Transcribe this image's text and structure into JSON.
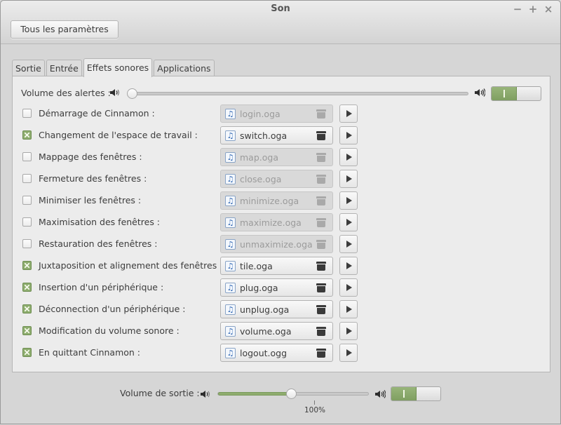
{
  "window": {
    "title": "Son",
    "controls": {
      "minimize": "−",
      "maximize": "+",
      "close": "×"
    }
  },
  "toolbar": {
    "all_settings_label": "Tous les paramètres"
  },
  "tabs": [
    {
      "label": "Sortie",
      "active": false
    },
    {
      "label": "Entrée",
      "active": false
    },
    {
      "label": "Effets sonores",
      "active": true
    },
    {
      "label": "Applications",
      "active": false
    }
  ],
  "alerts": {
    "label": "Volume des alertes :",
    "volume_fraction": 0.0,
    "enabled": true
  },
  "sound_events": [
    {
      "label": "Démarrage de Cinnamon :",
      "checked": false,
      "file": "login.oga"
    },
    {
      "label": "Changement de l'espace de travail :",
      "checked": true,
      "file": "switch.oga"
    },
    {
      "label": "Mappage des fenêtres :",
      "checked": false,
      "file": "map.oga"
    },
    {
      "label": "Fermeture des fenêtres :",
      "checked": false,
      "file": "close.oga"
    },
    {
      "label": "Minimiser les fenêtres :",
      "checked": false,
      "file": "minimize.oga"
    },
    {
      "label": "Maximisation des fenêtres :",
      "checked": false,
      "file": "maximize.oga"
    },
    {
      "label": "Restauration des fenêtres :",
      "checked": false,
      "file": "unmaximize.oga"
    },
    {
      "label": "Juxtaposition et alignement des fenêtres :",
      "checked": true,
      "file": "tile.oga"
    },
    {
      "label": "Insertion d'un périphérique :",
      "checked": true,
      "file": "plug.oga"
    },
    {
      "label": "Déconnection d'un périphérique :",
      "checked": true,
      "file": "unplug.oga"
    },
    {
      "label": "Modification du volume sonore :",
      "checked": true,
      "file": "volume.oga"
    },
    {
      "label": "En quittant Cinnamon :",
      "checked": true,
      "file": "logout.ogg"
    }
  ],
  "output": {
    "label": "Volume de sortie :",
    "volume_fraction": 0.49,
    "mark_label": "100%",
    "enabled": true
  },
  "colors": {
    "accent": "#8fac6e"
  }
}
